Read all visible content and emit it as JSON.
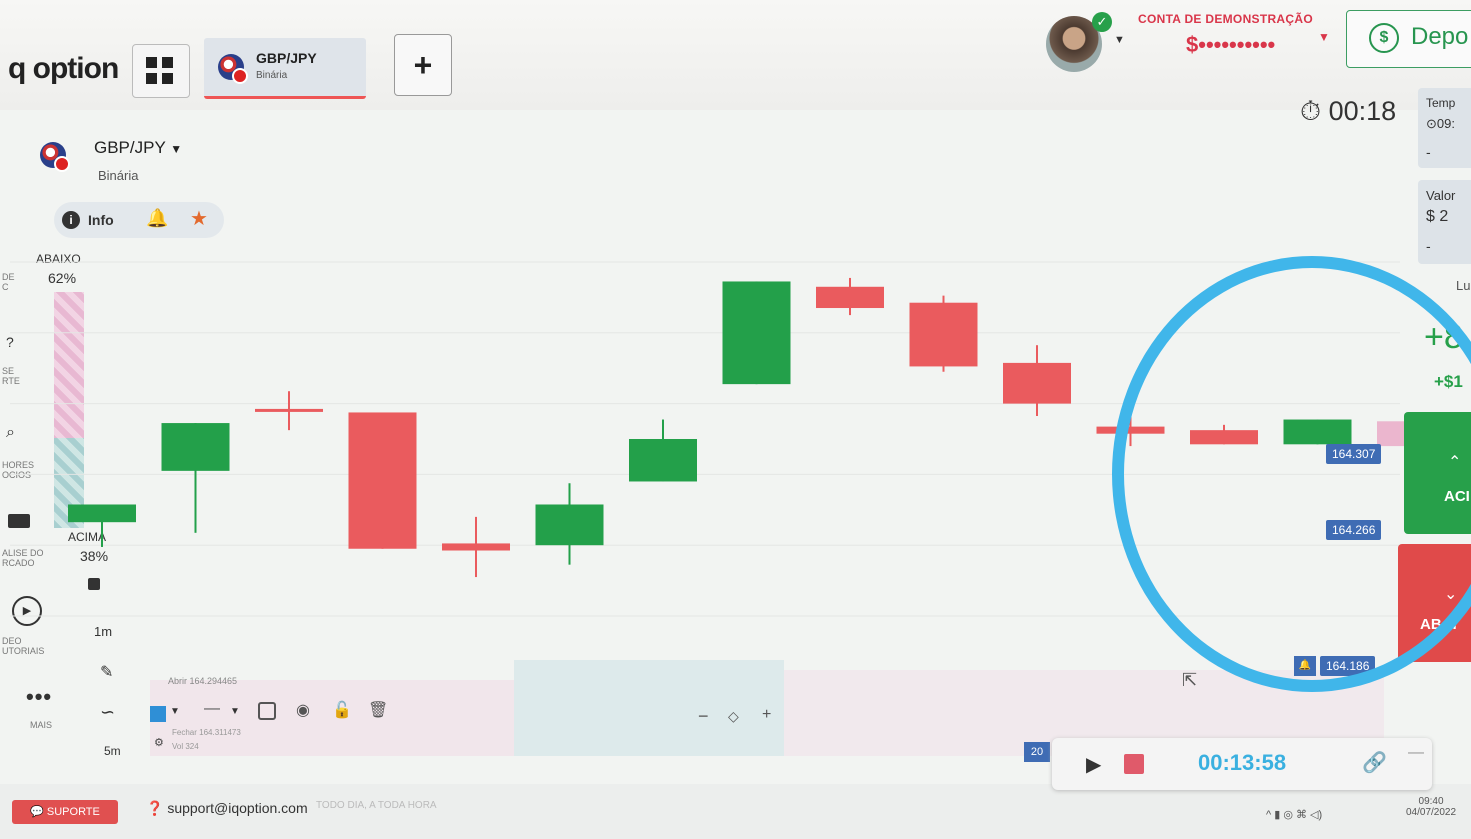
{
  "header": {
    "logo": "q option",
    "active_tab": {
      "asset": "GBP/JPY",
      "type": "Binária"
    },
    "add_tab_label": "+",
    "account_label": "CONTA DE DEMONSTRAÇÃO",
    "account_balance": "$••••••••••",
    "deposit_label": "Depo"
  },
  "asset_info": {
    "asset": "GBP/JPY",
    "type": "Binária",
    "info_label": "Info"
  },
  "sentiment": {
    "down_label": "ABAIXO",
    "down_pct": "62%",
    "up_label": "ACIMA",
    "up_pct": "38%",
    "down_fraction": 0.62,
    "colors": {
      "down": "#e8b8d2",
      "up": "#a8cfd0"
    }
  },
  "left_rail": [
    {
      "label": "DE\nC"
    },
    {
      "label": "SE\nRTE"
    },
    {
      "label": "HORES\nOCIOS"
    },
    {
      "label": "ALISE DO\nRCADO"
    },
    {
      "label": "DEO\nUTORIAIS"
    },
    {
      "label": "MAIS"
    }
  ],
  "chart_controls": {
    "timeframe_1": "1m",
    "timeframe_2": "5m",
    "ohlc_open": "Abrir  164.294465",
    "ohlc_close": "Fechar  164.311473",
    "ohlc_volume": "Vol  324",
    "zoom_minus": "−",
    "zoom_plus": "+"
  },
  "right_panel": {
    "timer": "00:18",
    "time_label": "Temp",
    "time_value": "09:",
    "amount_label": "Valor",
    "amount_value": "$ 2",
    "dash": "-",
    "profit_label": "Lu",
    "profit_pct": "+8",
    "profit_usd": "+$1",
    "call_label": "ACI",
    "put_label": "ABAI"
  },
  "price_tags": {
    "current_high": "164.307",
    "current_low": "164.266",
    "alert_price": "164.186"
  },
  "recorder": {
    "time": "00:13:58",
    "badge": "20"
  },
  "footer": {
    "support_label": "SUPORTE",
    "support_email": "support@iqoption.com",
    "support_hours": "TODO DIA, A TODA HORA",
    "clock_time": "09:40",
    "clock_date": "04/07/2022"
  },
  "colors": {
    "up_candle": "#23a04a",
    "down_candle": "#ea5b5e",
    "highlight_circle": "#40b6ea",
    "brand_red": "#d9364a"
  },
  "chart_data": {
    "type": "candlestick",
    "candles": [
      {
        "o": 164.233,
        "h": 164.243,
        "l": 164.219,
        "c": 164.243,
        "dir": "up"
      },
      {
        "o": 164.262,
        "h": 164.277,
        "l": 164.227,
        "c": 164.289,
        "dir": "up"
      },
      {
        "o": 164.297,
        "h": 164.307,
        "l": 164.285,
        "c": 164.297,
        "dir": "down"
      },
      {
        "o": 164.295,
        "h": 164.295,
        "l": 164.218,
        "c": 164.218,
        "dir": "down"
      },
      {
        "o": 164.221,
        "h": 164.236,
        "l": 164.202,
        "c": 164.217,
        "dir": "down"
      },
      {
        "o": 164.22,
        "h": 164.255,
        "l": 164.209,
        "c": 164.243,
        "dir": "up"
      },
      {
        "o": 164.256,
        "h": 164.291,
        "l": 164.256,
        "c": 164.28,
        "dir": "up"
      },
      {
        "o": 164.311,
        "h": 164.311,
        "l": 164.311,
        "c": 164.369,
        "dir": "up"
      },
      {
        "o": 164.366,
        "h": 164.371,
        "l": 164.35,
        "c": 164.354,
        "dir": "down"
      },
      {
        "o": 164.357,
        "h": 164.361,
        "l": 164.318,
        "c": 164.321,
        "dir": "down"
      },
      {
        "o": 164.323,
        "h": 164.333,
        "l": 164.293,
        "c": 164.3,
        "dir": "down"
      },
      {
        "o": 164.287,
        "h": 164.303,
        "l": 164.276,
        "c": 164.283,
        "dir": "down"
      },
      {
        "o": 164.285,
        "h": 164.288,
        "l": 164.278,
        "c": 164.277,
        "dir": "down"
      },
      {
        "o": 164.277,
        "h": 164.291,
        "l": 164.277,
        "c": 164.291,
        "dir": "up"
      },
      {
        "o": 164.29,
        "h": 164.292,
        "l": 164.275,
        "c": 164.276,
        "dir": "live"
      }
    ],
    "ylim": [
      164.18,
      164.38
    ]
  }
}
